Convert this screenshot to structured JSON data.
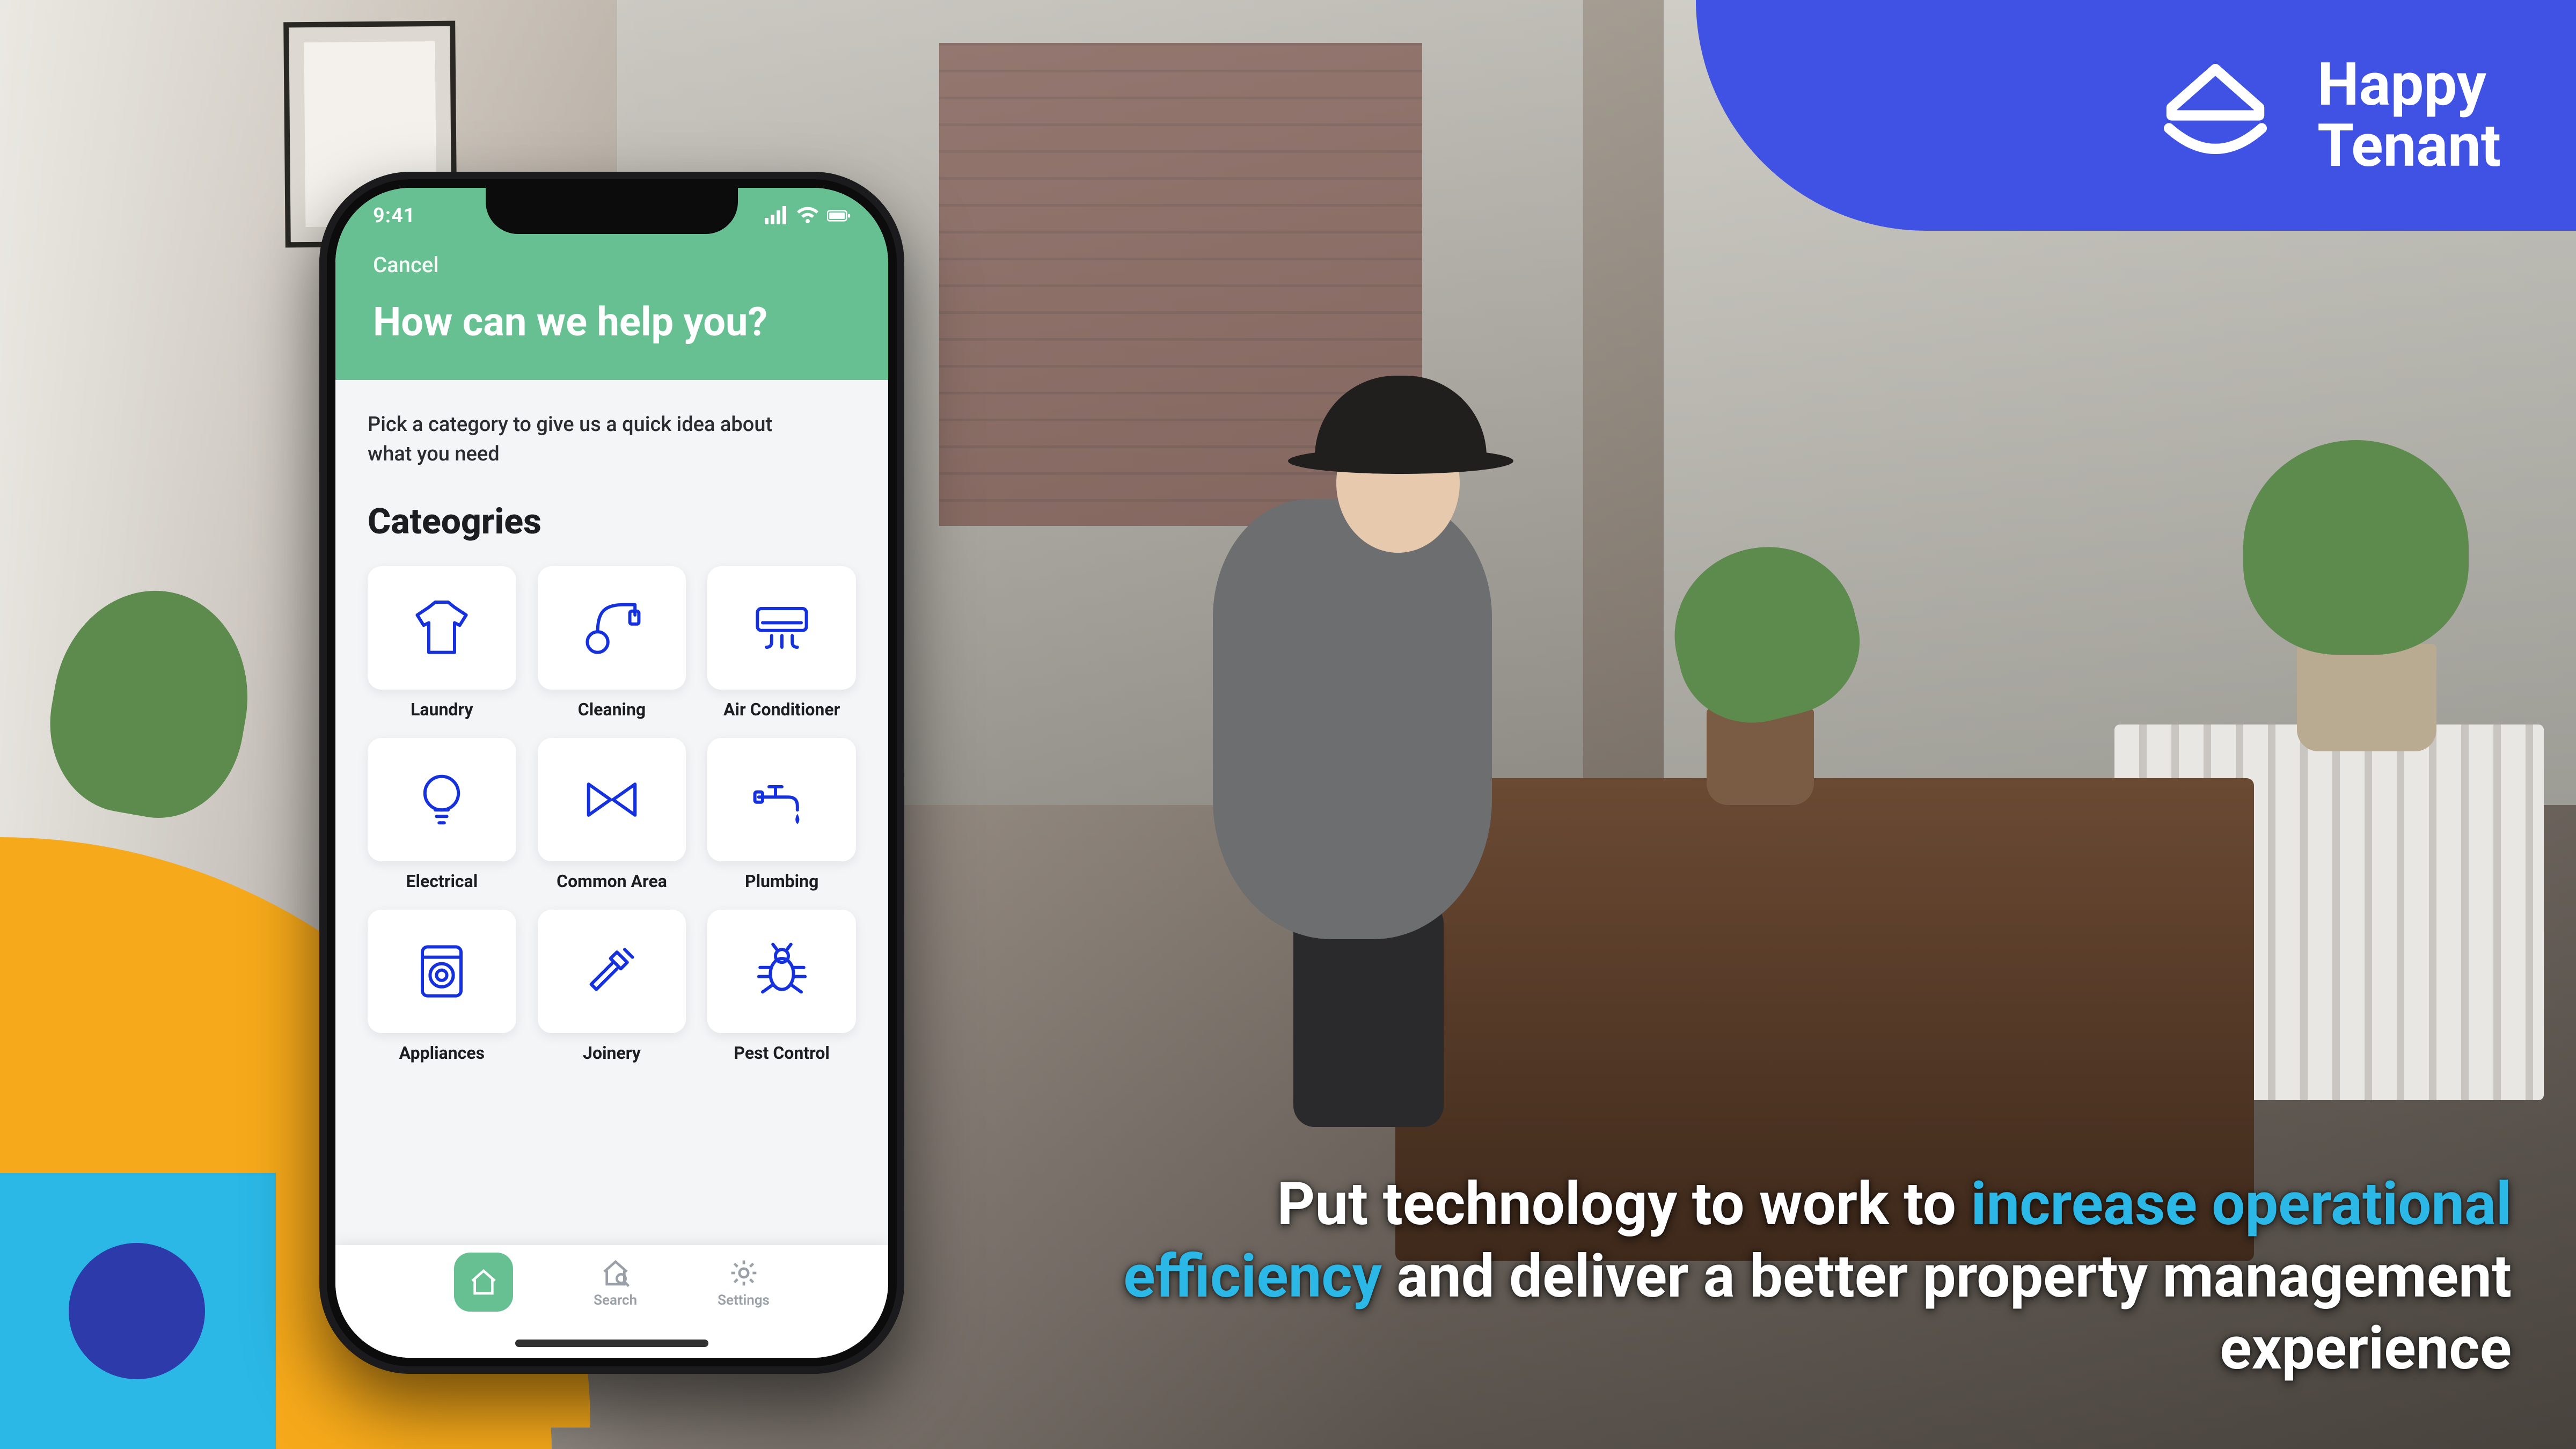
{
  "brand": {
    "line1": "Happy",
    "line2": "Tenant"
  },
  "tagline": {
    "pre": "Put technology to work to ",
    "hl1": "increase operational efficiency",
    "mid": " and deliver a better property management experience"
  },
  "colors": {
    "brand_blue": "#4052E3",
    "accent_cyan": "#2BB8E6",
    "shape_yellow": "#F6A91A",
    "shape_navy": "#2C3AAA",
    "app_green": "#67C092",
    "icon_blue": "#1531DE"
  },
  "phone": {
    "status_time": "9:41",
    "cancel_label": "Cancel",
    "title": "How can we help you?",
    "helper_text": "Pick a category to give us a quick idea about what you need",
    "section_heading": "Cateogries",
    "categories": [
      {
        "icon": "tshirt-icon",
        "label": "Laundry"
      },
      {
        "icon": "vacuum-icon",
        "label": "Cleaning"
      },
      {
        "icon": "ac-icon",
        "label": "Air Conditioner"
      },
      {
        "icon": "bulb-icon",
        "label": "Electrical"
      },
      {
        "icon": "bowtie-icon",
        "label": "Common Area"
      },
      {
        "icon": "faucet-icon",
        "label": "Plumbing"
      },
      {
        "icon": "washer-icon",
        "label": "Appliances"
      },
      {
        "icon": "hammer-icon",
        "label": "Joinery"
      },
      {
        "icon": "bug-icon",
        "label": "Pest Control"
      }
    ],
    "tabs": {
      "home": {
        "label": ""
      },
      "search": {
        "label": "Search"
      },
      "settings": {
        "label": "Settings"
      }
    }
  }
}
